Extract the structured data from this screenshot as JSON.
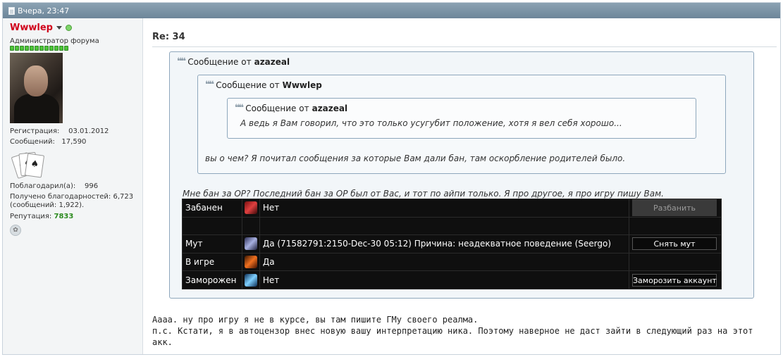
{
  "header": {
    "date": "Вчера, 23:47"
  },
  "user": {
    "name": "Wwwlep",
    "title": "Администратор форума",
    "reg_label": "Регистрация:",
    "reg_value": "03.01.2012",
    "posts_label": "Сообщений:",
    "posts_value": "17,590",
    "thanked_label": "Поблагодарил(а):",
    "thanked_value": "996",
    "thanks_received_line1": "Получено благодарностей: 6,723",
    "thanks_received_line2": "(сообщений: 1,922).",
    "rep_label": "Репутация:",
    "rep_value": "7833",
    "rep_bar_segments": 12
  },
  "post": {
    "title": "Re: 34",
    "quote_label": "Сообщение от",
    "quote1_author": "azazeal",
    "quote2_author": "Wwwlep",
    "quote3_author": "azazeal",
    "quote3_text": "А ведь я Вам говорил, что это только усугубит положение, хотя я вел себя хорошо...",
    "quote2_text": "вы о чем? Я почитал сообщения за которые Вам дали бан, там оскорбление родителей было.",
    "quote1_text": "Мне бан за ОР? Последний бан за ОР был от Вас, и тот по айпи только. Я про другое, я про игру пишу Вам.",
    "after_line1": "Аааа. ну про игру я не в курсе, вы там пишите ГМу своего реалма.",
    "after_line2": "п.с. Кстати, я в автоцензор внес новую вашу интерпретацию ника. Поэтому наверное не даст зайти в следующий раз на этот",
    "after_line3": "акк."
  },
  "gm_table": {
    "banned_label": "Забанен",
    "banned_value": "Нет",
    "unban_button": "Разбанить",
    "mute_label": "Мут",
    "mute_value": "Да (71582791:2150-Dec-30 05:12) Причина: неадекватное поведение (Seergo)",
    "unmute_button": "Снять мут",
    "ingame_label": "В игре",
    "ingame_value": "Да",
    "frozen_label": "Заморожен",
    "frozen_value": "Нет",
    "freeze_button": "Заморозить аккаунт"
  },
  "icons": {
    "header": "document-icon",
    "quote": "quote-icon",
    "ban": "ban-icon",
    "mute": "mute-icon",
    "ingame": "ingame-icon",
    "frozen": "frozen-icon",
    "thanks": "gift-icon"
  },
  "colors": {
    "username": "#d0021b",
    "reputation": "#2b8a1e",
    "header_bg": "#7a92a5",
    "quote_border": "#8ea7bc"
  }
}
